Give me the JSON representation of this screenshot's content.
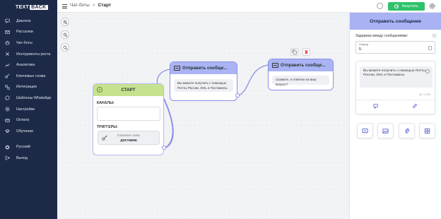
{
  "app": {
    "logo_text": "TEXT",
    "logo_badge": "BACK"
  },
  "sidebar": {
    "items": [
      {
        "label": "Диалоги",
        "icon": "dialog-icon"
      },
      {
        "label": "Рассылки",
        "icon": "mail-icon"
      },
      {
        "label": "Чат-боты",
        "icon": "bot-icon"
      },
      {
        "label": "Инструменты роста",
        "icon": "tools-icon"
      },
      {
        "label": "Аналитика",
        "icon": "chart-icon"
      },
      {
        "label": "Ключевые слова",
        "icon": "key-icon"
      },
      {
        "label": "Интеграции",
        "icon": "integration-icon"
      },
      {
        "label": "Шаблоны WhatsApp",
        "icon": "whatsapp-icon"
      },
      {
        "label": "Настройки",
        "icon": "gear-icon"
      },
      {
        "label": "Оплата",
        "icon": "card-icon"
      },
      {
        "label": "Обучение",
        "icon": "education-icon"
      }
    ],
    "language": "Русский",
    "logout": "Выход"
  },
  "topbar": {
    "breadcrumb_parent": "Чат-боты",
    "breadcrumb_separator": ">",
    "breadcrumb_current": "Старт",
    "run_label": "Запустить"
  },
  "canvas": {
    "start_node": {
      "title": "СТАРТ",
      "channels_label": "КАНАЛЫ:",
      "triggers_label": "ТРИГГЕРЫ:",
      "trigger_type": "Ключевое слово",
      "trigger_value": "доставка"
    },
    "message_node_1": {
      "title": "Отправить сообще...",
      "text": "Вы можете получить с помощью Почты России, DHL и Постаматы."
    },
    "message_node_2": {
      "title": "Отправить сообще...",
      "text": "Скажите, я ответил на ваш вопрос?"
    }
  },
  "panel": {
    "title": "Отправить сообщение",
    "delay_label": "Задержка между сообщениями:",
    "delay_unit": "Секунд",
    "delay_value": "5",
    "message_text": "Вы можете получить с помощью Почты России, DHL и Постаматы.",
    "char_counter": "60 / 4750"
  },
  "colors": {
    "sidebar_bg": "#1c2a48",
    "accent_green": "#2ec26b",
    "node_header_purple": "#aab3f3",
    "start_header_green": "#c6e28f"
  }
}
